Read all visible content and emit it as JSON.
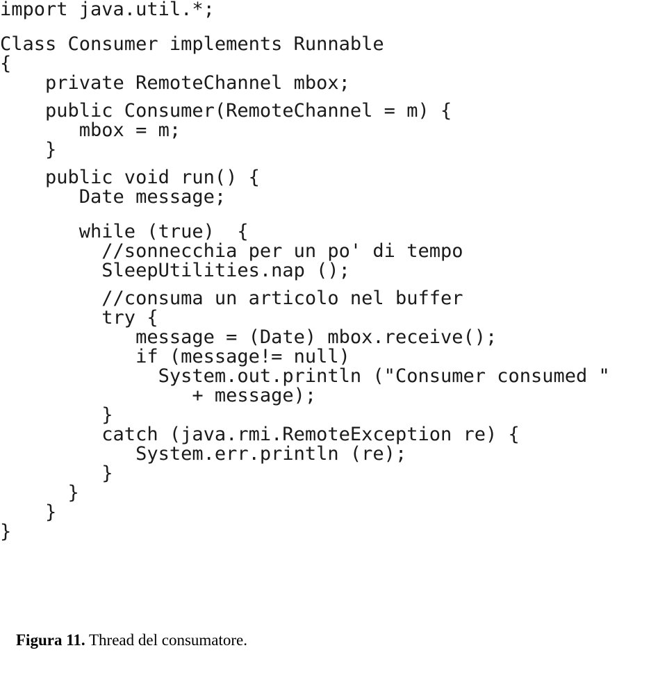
{
  "document": {
    "code_lines": [
      {
        "text": "import java.util.*;",
        "spacing": "none"
      },
      {
        "text": "Class Consumer implements Runnable",
        "spacing": "gap-md"
      },
      {
        "text": "{",
        "spacing": "none"
      },
      {
        "text": "    private RemoteChannel mbox;",
        "spacing": "none"
      },
      {
        "text": "    public Consumer(RemoteChannel = m) {",
        "spacing": "gap-sm"
      },
      {
        "text": "       mbox = m;",
        "spacing": "none"
      },
      {
        "text": "    }",
        "spacing": "none"
      },
      {
        "text": "    public void run() {",
        "spacing": "gap-sm"
      },
      {
        "text": "       Date message;",
        "spacing": "none"
      },
      {
        "text": "       while (true)  {",
        "spacing": "gap-md"
      },
      {
        "text": "         //sonnecchia per un po' di tempo",
        "spacing": "none"
      },
      {
        "text": "         SleepUtilities.nap ();",
        "spacing": "none"
      },
      {
        "text": "         //consuma un articolo nel buffer",
        "spacing": "gap-sm"
      },
      {
        "text": "         try {",
        "spacing": "none"
      },
      {
        "text": "            message = (Date) mbox.receive();",
        "spacing": "none"
      },
      {
        "text": "            if (message!= null)",
        "spacing": "none"
      },
      {
        "text": "              System.out.println (\"Consumer consumed \"",
        "spacing": "none"
      },
      {
        "text": "                 + message);",
        "spacing": "none"
      },
      {
        "text": "         }",
        "spacing": "none"
      },
      {
        "text": "         catch (java.rmi.RemoteException re) {",
        "spacing": "none"
      },
      {
        "text": "            System.err.println (re);",
        "spacing": "none"
      },
      {
        "text": "         }",
        "spacing": "none"
      },
      {
        "text": "      }",
        "spacing": "none"
      },
      {
        "text": "    }",
        "spacing": "none"
      },
      {
        "text": "}",
        "spacing": "none"
      }
    ],
    "caption": {
      "label": "Figura 11.",
      "text": " Thread del consumatore."
    }
  }
}
